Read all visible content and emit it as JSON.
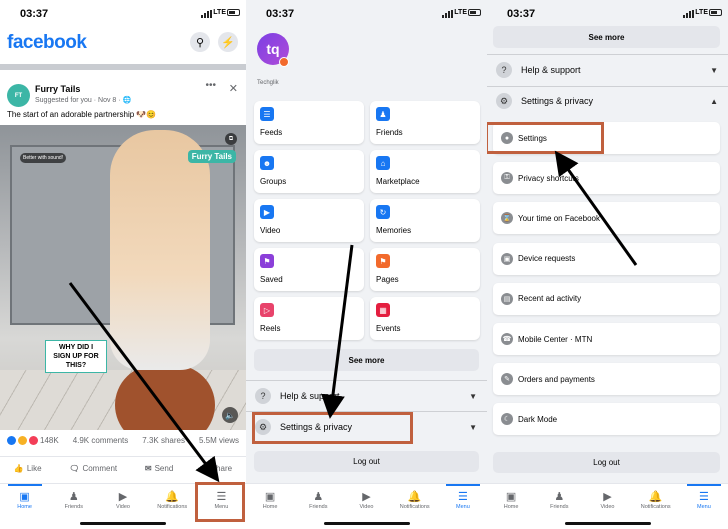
{
  "status_bar": {
    "time": "03:37",
    "network": "LTE"
  },
  "panel1": {
    "logo": "facebook",
    "post": {
      "author": "Furry Tails",
      "avatar_text": "Furry Tails",
      "meta": "Suggested for you · Nov 8 · 🌐",
      "caption": "The start of an adorable partnership 🐶😊",
      "video_tags": {
        "sound": "Better with sound!",
        "brand": "Furry Tails",
        "overlay": "WHY DID I SIGN UP FOR THIS?"
      },
      "reactions_count": "148K",
      "comments": "4.9K comments",
      "shares": "7.3K shares",
      "views": "5.5M views",
      "actions": [
        "Like",
        "Comment",
        "Send",
        "Share"
      ]
    }
  },
  "panel2": {
    "profile_initials": "tq",
    "profile_name": "Techglik",
    "shortcuts": [
      {
        "label": "Feeds",
        "color": "#1877f2",
        "icon": "feeds-icon"
      },
      {
        "label": "Friends",
        "color": "#1877f2",
        "icon": "friends-icon"
      },
      {
        "label": "Groups",
        "color": "#1877f2",
        "icon": "groups-icon"
      },
      {
        "label": "Marketplace",
        "color": "#1877f2",
        "icon": "marketplace-icon"
      },
      {
        "label": "Video",
        "color": "#1877f2",
        "icon": "video-icon"
      },
      {
        "label": "Memories",
        "color": "#1877f2",
        "icon": "memories-icon"
      },
      {
        "label": "Saved",
        "color": "#8b3fd9",
        "icon": "saved-icon"
      },
      {
        "label": "Pages",
        "color": "#f26a2c",
        "icon": "pages-icon"
      },
      {
        "label": "Reels",
        "color": "#e8436b",
        "icon": "reels-icon"
      },
      {
        "label": "Events",
        "color": "#e41e3f",
        "icon": "events-icon"
      }
    ],
    "see_more": "See more",
    "help_support": "Help & support",
    "settings_privacy": "Settings & privacy",
    "log_out": "Log out"
  },
  "panel3": {
    "see_more": "See more",
    "help_support": "Help & support",
    "settings_privacy": "Settings & privacy",
    "settings_items": [
      "Settings",
      "Privacy shortcuts",
      "Your time on Facebook",
      "Device requests",
      "Recent ad activity",
      "Mobile Center · MTN",
      "Orders and payments",
      "Dark Mode"
    ],
    "log_out": "Log out"
  },
  "tab_bar": [
    "Home",
    "Friends",
    "Video",
    "Notifications",
    "Menu"
  ],
  "colors": {
    "brand": "#1877f2",
    "highlight": "#c0603e",
    "background": "#f0f2f5"
  }
}
